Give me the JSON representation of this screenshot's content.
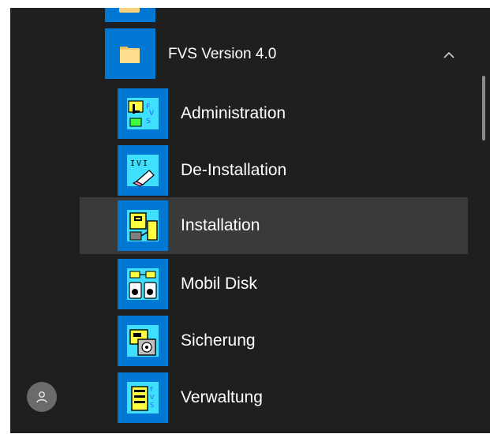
{
  "start_menu": {
    "group": {
      "label": "FVS Version 4.0",
      "expanded": true,
      "icon": "folder-icon",
      "chevron": "chevron-up-icon"
    },
    "items": [
      {
        "label": "Administration",
        "icon": "administration-app-icon",
        "hovered": false
      },
      {
        "label": "De-Installation",
        "icon": "uninstall-app-icon",
        "hovered": false
      },
      {
        "label": "Installation",
        "icon": "installation-app-icon",
        "hovered": true
      },
      {
        "label": "Mobil Disk",
        "icon": "mobile-disk-app-icon",
        "hovered": false
      },
      {
        "label": "Sicherung",
        "icon": "backup-app-icon",
        "hovered": false
      },
      {
        "label": "Verwaltung",
        "icon": "management-app-icon",
        "hovered": false
      }
    ],
    "user": {
      "icon": "user-avatar-icon"
    }
  },
  "colors": {
    "panel_bg": "#1f1f1f",
    "tile_blue": "#0078d4",
    "hover_bg": "#3a3a3a",
    "text": "#ffffff",
    "folder_yellow": "#f6d27a"
  }
}
